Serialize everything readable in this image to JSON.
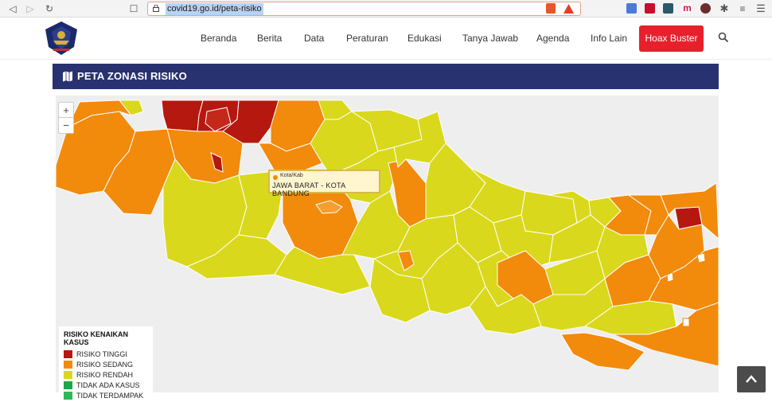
{
  "browser": {
    "url": "covid19.go.id/peta-risiko"
  },
  "nav": {
    "items": [
      "Beranda",
      "Berita",
      "Data",
      "Peraturan",
      "Edukasi",
      "Tanya Jawab",
      "Agenda",
      "Info Lain"
    ],
    "hoax_label": "Hoax Buster"
  },
  "section": {
    "title": "PETA ZONASI RISIKO"
  },
  "map": {
    "zoom_in": "+",
    "zoom_out": "−",
    "tooltip": {
      "sub": "Kota/Kab",
      "main": "JAWA BARAT - KOTA BANDUNG"
    }
  },
  "legend": {
    "title": "RISIKO KENAIKAN KASUS",
    "items": [
      {
        "label": "RISIKO TINGGI",
        "color": "#b5180f"
      },
      {
        "label": "RISIKO SEDANG",
        "color": "#f28a0c"
      },
      {
        "label": "RISIKO RENDAH",
        "color": "#d9d81c"
      },
      {
        "label": "TIDAK ADA KASUS",
        "color": "#1aa84a"
      },
      {
        "label": "TIDAK TERDAMPAK",
        "color": "#2fb85a"
      }
    ]
  },
  "colors": {
    "high": "#b5180f",
    "medium": "#f28a0c",
    "low": "#d9d81c",
    "header_bar": "#283271",
    "hoax_button": "#e8202c"
  }
}
